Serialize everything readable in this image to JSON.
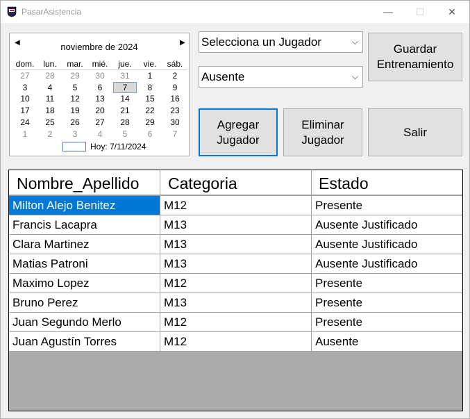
{
  "window": {
    "title": "PasarAsistencia",
    "controls": {
      "minimize": "—",
      "maximize": "☐",
      "close": "✕"
    }
  },
  "calendar": {
    "prev": "◀",
    "next": "▶",
    "month_title": "noviembre de 2024",
    "weekdays": [
      "dom.",
      "lun.",
      "mar.",
      "mié.",
      "jue.",
      "vie.",
      "sáb."
    ],
    "weeks": [
      [
        {
          "d": "27",
          "o": true
        },
        {
          "d": "28",
          "o": true
        },
        {
          "d": "29",
          "o": true
        },
        {
          "d": "30",
          "o": true
        },
        {
          "d": "31",
          "o": true
        },
        {
          "d": "1"
        },
        {
          "d": "2"
        }
      ],
      [
        {
          "d": "3"
        },
        {
          "d": "4"
        },
        {
          "d": "5"
        },
        {
          "d": "6"
        },
        {
          "d": "7",
          "s": true
        },
        {
          "d": "8"
        },
        {
          "d": "9"
        }
      ],
      [
        {
          "d": "10"
        },
        {
          "d": "11"
        },
        {
          "d": "12"
        },
        {
          "d": "13"
        },
        {
          "d": "14"
        },
        {
          "d": "15"
        },
        {
          "d": "16"
        }
      ],
      [
        {
          "d": "17"
        },
        {
          "d": "18"
        },
        {
          "d": "19"
        },
        {
          "d": "20"
        },
        {
          "d": "21"
        },
        {
          "d": "22"
        },
        {
          "d": "23"
        }
      ],
      [
        {
          "d": "24"
        },
        {
          "d": "25"
        },
        {
          "d": "26"
        },
        {
          "d": "27"
        },
        {
          "d": "28"
        },
        {
          "d": "29"
        },
        {
          "d": "30"
        }
      ],
      [
        {
          "d": "1",
          "o": true
        },
        {
          "d": "2",
          "o": true
        },
        {
          "d": "3",
          "o": true
        },
        {
          "d": "4",
          "o": true
        },
        {
          "d": "5",
          "o": true
        },
        {
          "d": "6",
          "o": true
        },
        {
          "d": "7",
          "o": true
        }
      ]
    ],
    "today_label": "Hoy: 7/11/2024"
  },
  "player_select": {
    "value": "Selecciona un Jugador",
    "arrow": "⌵"
  },
  "status_select": {
    "value": "Ausente",
    "arrow": "⌵"
  },
  "buttons": {
    "save_line1": "Guardar",
    "save_line2": "Entrenamiento",
    "add_line1": "Agregar",
    "add_line2": "Jugador",
    "delete_line1": "Eliminar",
    "delete_line2": "Jugador",
    "exit": "Salir"
  },
  "grid": {
    "headers": [
      "Nombre_Apellido",
      "Categoria",
      "Estado"
    ],
    "rows": [
      [
        "Milton Alejo Benitez",
        "M12",
        "Presente"
      ],
      [
        "Francis Lacapra",
        "M13",
        "Ausente Justificado"
      ],
      [
        "Clara Martinez",
        "M13",
        "Ausente Justificado"
      ],
      [
        "Matias Patroni",
        "M13",
        "Ausente Justificado"
      ],
      [
        "Maximo Lopez",
        "M12",
        "Presente"
      ],
      [
        "Bruno Perez",
        "M13",
        "Presente"
      ],
      [
        "Juan Segundo Merlo",
        "M12",
        "Presente"
      ],
      [
        "Juan Agustín Torres",
        "M12",
        "Ausente"
      ]
    ],
    "selected_row": 0
  },
  "colors": {
    "accent": "#0078d7",
    "grid_background": "#ababab",
    "button_face": "#e1e1e1"
  }
}
